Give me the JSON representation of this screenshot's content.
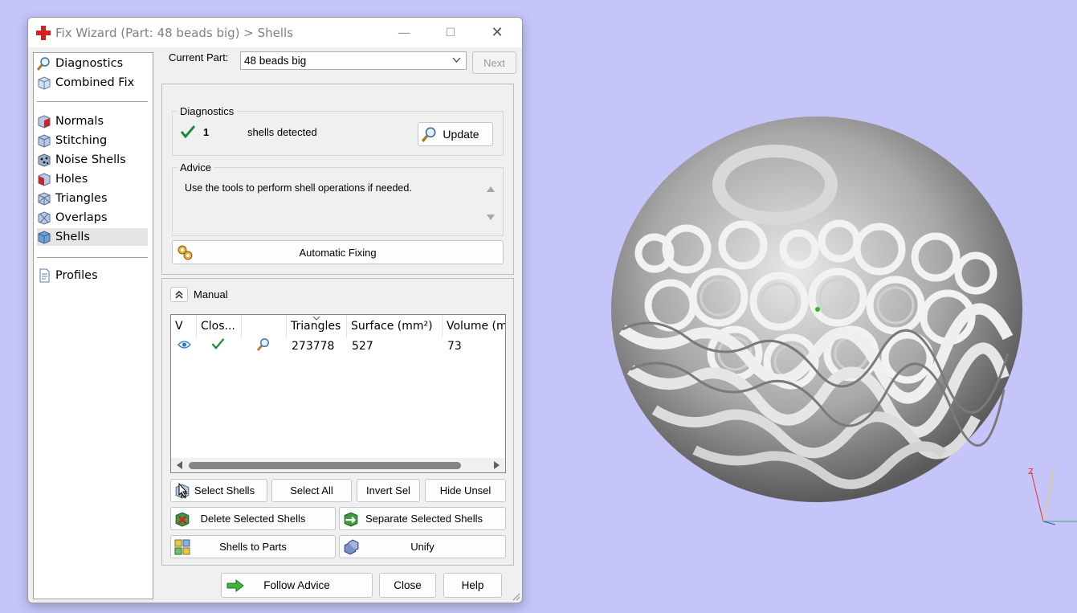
{
  "window": {
    "title": "Fix Wizard (Part: 48 beads big) > Shells",
    "buttons": {
      "minimize": "—",
      "maximize": "☐",
      "close": "✕"
    }
  },
  "nav": {
    "top_items": [
      {
        "label": "Diagnostics",
        "icon": "magnifier-icon"
      },
      {
        "label": "Combined Fix",
        "icon": "cube-icon"
      }
    ],
    "fix_items": [
      {
        "label": "Normals",
        "icon": "normals-cube-icon"
      },
      {
        "label": "Stitching",
        "icon": "stitching-cube-icon"
      },
      {
        "label": "Noise Shells",
        "icon": "noise-shells-icon"
      },
      {
        "label": "Holes",
        "icon": "holes-cube-icon"
      },
      {
        "label": "Triangles",
        "icon": "triangles-cube-icon"
      },
      {
        "label": "Overlaps",
        "icon": "overlaps-cube-icon"
      },
      {
        "label": "Shells",
        "icon": "shells-cube-icon",
        "selected": true
      }
    ],
    "bottom_items": [
      {
        "label": "Profiles",
        "icon": "document-icon"
      }
    ]
  },
  "current_part": {
    "label": "Current Part:",
    "value": "48 beads big",
    "next_label": "Next"
  },
  "diagnostics": {
    "title": "Diagnostics",
    "count": "1",
    "text": "shells detected",
    "update_label": "Update"
  },
  "advice": {
    "title": "Advice",
    "text": "Use the tools to perform shell operations if needed."
  },
  "automatic_fixing_label": "Automatic Fixing",
  "manual": {
    "label": "Manual",
    "table": {
      "columns": [
        "V",
        "Clos...",
        "",
        "Triangles",
        "Surface (mm²)",
        "Volume (m"
      ],
      "rows": [
        {
          "visible": "eye-icon",
          "closed": "checkmark-icon",
          "detail": "magnifier-icon",
          "triangles": "273778",
          "surface": "527",
          "volume": "73"
        }
      ]
    },
    "buttons": {
      "select_shells": "Select Shells",
      "select_all": "Select All",
      "invert_sel": "Invert Sel",
      "hide_unsel": "Hide Unsel",
      "delete_selected": "Delete Selected Shells",
      "separate_selected": "Separate Selected Shells",
      "shells_to_parts": "Shells to Parts",
      "unify": "Unify"
    }
  },
  "footer": {
    "follow_advice": "Follow Advice",
    "close": "Close",
    "help": "Help"
  },
  "viewport": {
    "axis_z": "Z",
    "background": "#c5c5fa"
  }
}
